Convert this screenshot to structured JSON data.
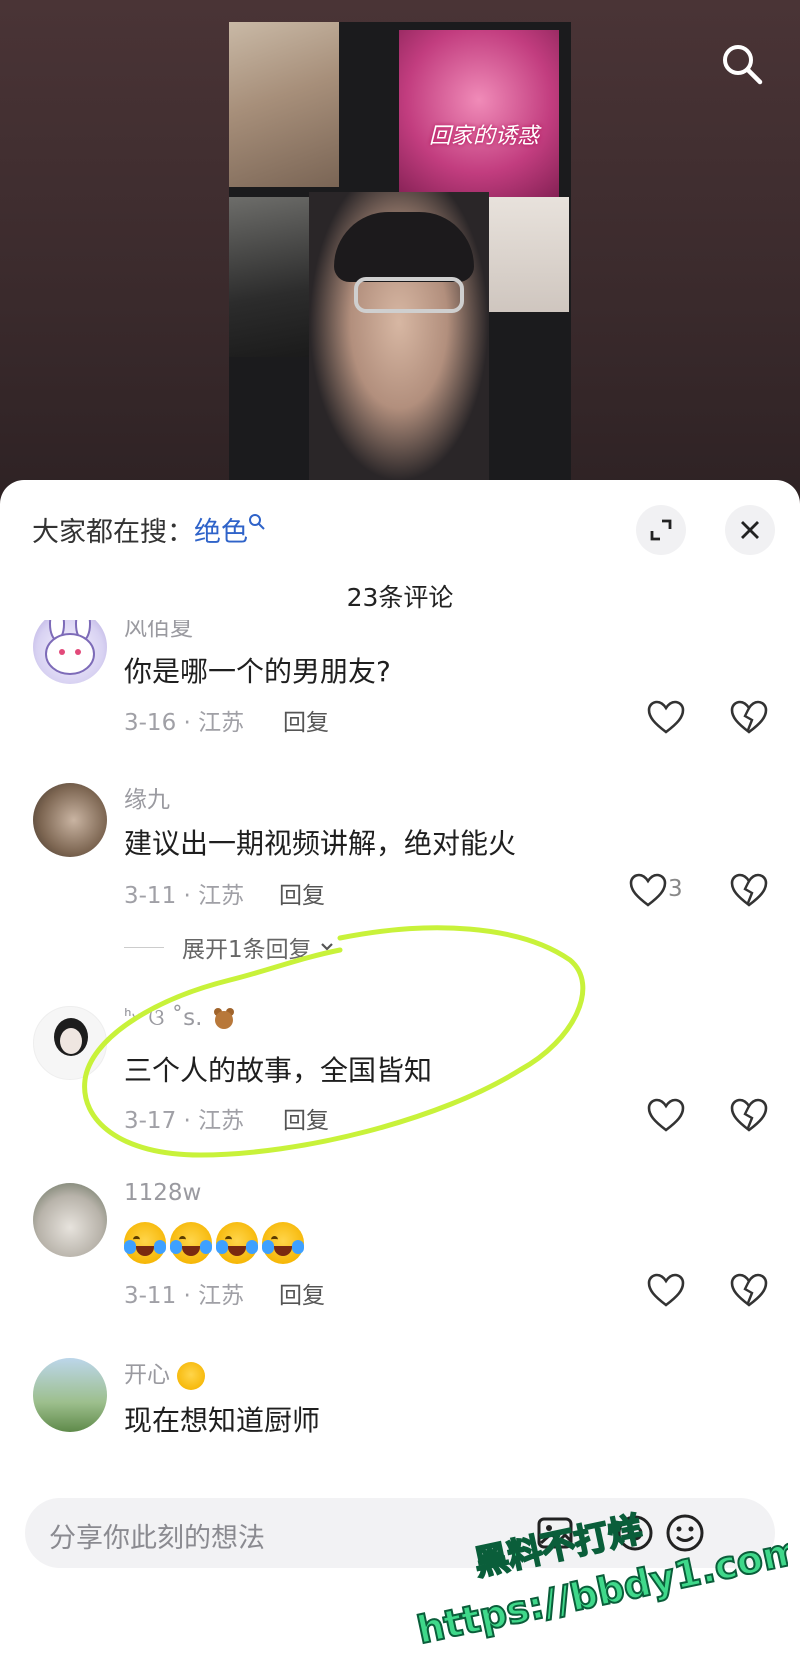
{
  "poster_title": "回家的诱惑",
  "trending": {
    "label": "大家都在搜：",
    "keyword": "绝色"
  },
  "comment_count": "23条评论",
  "comments": [
    {
      "user": "风佰夏",
      "text": "你是哪一个的男朋友?",
      "meta": "3-16 · 江苏",
      "reply": "回复",
      "likes": ""
    },
    {
      "user": "缘九",
      "text": "建议出一期视频讲解，绝对能火",
      "meta": "3-11 · 江苏",
      "reply": "回复",
      "likes": "3",
      "expand": "展开1条回复"
    },
    {
      "user": "ᑋᵕ ଓ ˚s.",
      "text": "三个人的故事，全国皆知",
      "meta": "3-17 · 江苏",
      "reply": "回复",
      "likes": ""
    },
    {
      "user": "1128w",
      "text": "",
      "meta": "3-11 · 江苏",
      "reply": "回复",
      "likes": ""
    },
    {
      "user": "开心",
      "text": "现在想知道厨师",
      "meta": "",
      "reply": "",
      "likes": ""
    }
  ],
  "input": {
    "placeholder": "分享你此刻的想法"
  },
  "watermark": {
    "line1": "黑料不打烊",
    "line2": "https://bbdy1.com"
  },
  "colors": {
    "accent_link": "#2f63c9",
    "highlight": "#c8f23a",
    "watermark": "#3fd88a"
  },
  "icons": [
    "search-icon",
    "expand-icon",
    "close-icon",
    "heart-icon",
    "broken-heart-icon",
    "image-icon",
    "at-icon",
    "emoji-icon",
    "magnifier-icon"
  ]
}
